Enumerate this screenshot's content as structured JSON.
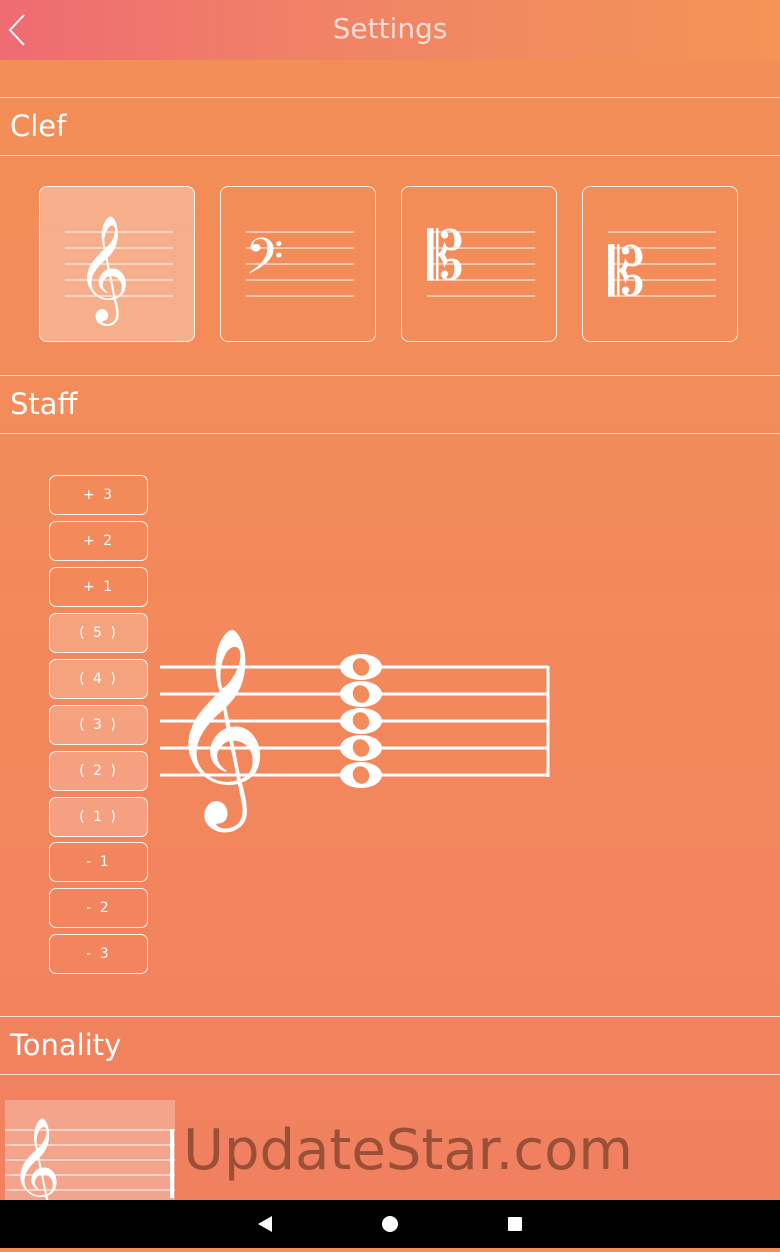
{
  "header": {
    "title": "Settings",
    "back_icon": "chevron-left-icon"
  },
  "sections": {
    "clef": "Clef",
    "staff": "Staff",
    "tonality": "Tonality"
  },
  "clef_options": [
    {
      "name": "treble",
      "icon": "treble-clef-icon",
      "selected": true
    },
    {
      "name": "bass",
      "icon": "bass-clef-icon",
      "selected": false
    },
    {
      "name": "alto",
      "icon": "alto-clef-icon",
      "selected": false
    },
    {
      "name": "tenor",
      "icon": "tenor-clef-icon",
      "selected": false
    }
  ],
  "staff_levels": [
    {
      "label": "+ 3",
      "active": false
    },
    {
      "label": "+ 2",
      "active": false
    },
    {
      "label": "+ 1",
      "active": false
    },
    {
      "label": "( 5 )",
      "active": true
    },
    {
      "label": "( 4 )",
      "active": true
    },
    {
      "label": "( 3 )",
      "active": true
    },
    {
      "label": "( 2 )",
      "active": true
    },
    {
      "label": "( 1 )",
      "active": true
    },
    {
      "label": "- 1",
      "active": false
    },
    {
      "label": "- 2",
      "active": false
    },
    {
      "label": "- 3",
      "active": false
    }
  ],
  "watermark": "UpdateStar.com",
  "colors": {
    "accent_start": "#ef6b72",
    "accent_end": "#f49456",
    "background": "#f38f57"
  },
  "navbar": {
    "back": "back-triangle-icon",
    "home": "home-circle-icon",
    "recents": "recents-square-icon"
  }
}
